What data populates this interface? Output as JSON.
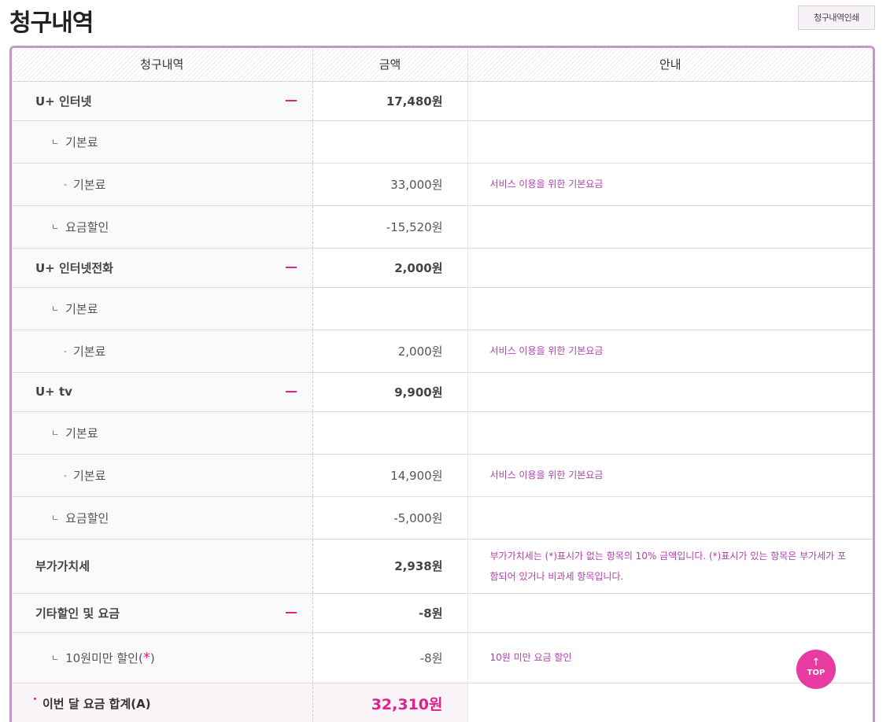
{
  "page": {
    "title": "청구내역",
    "print_button": "청구내역인쇄"
  },
  "table": {
    "headers": [
      "청구내역",
      "금액",
      "안내"
    ],
    "rows": [
      {
        "level": 0,
        "name": "U+ 인터넷",
        "amount": "17,480원",
        "info": "",
        "collapsible": true
      },
      {
        "level": 1,
        "marker": "ㄴ",
        "name": "기본료",
        "amount": "",
        "info": ""
      },
      {
        "level": 2,
        "marker": "-",
        "name": "기본료",
        "amount": "33,000원",
        "info": "서비스 이용을 위한 기본요금"
      },
      {
        "level": 1,
        "marker": "ㄴ",
        "name": "요금할인",
        "amount": "-15,520원",
        "info": ""
      },
      {
        "level": 0,
        "name": "U+ 인터넷전화",
        "amount": "2,000원",
        "info": "",
        "collapsible": true
      },
      {
        "level": 1,
        "marker": "ㄴ",
        "name": "기본료",
        "amount": "",
        "info": ""
      },
      {
        "level": 2,
        "marker": "-",
        "name": "기본료",
        "amount": "2,000원",
        "info": "서비스 이용을 위한 기본요금"
      },
      {
        "level": 0,
        "name": "U+ tv",
        "amount": "9,900원",
        "info": "",
        "collapsible": true
      },
      {
        "level": 1,
        "marker": "ㄴ",
        "name": "기본료",
        "amount": "",
        "info": ""
      },
      {
        "level": 2,
        "marker": "-",
        "name": "기본료",
        "amount": "14,900원",
        "info": "서비스 이용을 위한 기본요금"
      },
      {
        "level": 1,
        "marker": "ㄴ",
        "name": "요금할인",
        "amount": "-5,000원",
        "info": ""
      },
      {
        "level": 0,
        "name": "부가가치세",
        "amount": "2,938원",
        "info": "부가가치세는 (*)표시가 없는 항목의 10% 금액입니다. (*)표시가 있는 항목은 부가세가 포함되어 있거나 비과세 항목입니다.",
        "collapsible": false
      },
      {
        "level": 0,
        "name": "기타할인 및 요금",
        "amount": "-8원",
        "info": "",
        "collapsible": true
      },
      {
        "level": 1,
        "marker": "ㄴ",
        "name": "10원미만 할인",
        "asterisk": "(*)",
        "amount": "-8원",
        "info": "10원 미만 요금 할인"
      }
    ],
    "total": {
      "label": "이번 달 요금 합계(A)",
      "amount": "32,310원"
    }
  },
  "top_button": {
    "arrow": "↑",
    "label": "TOP"
  },
  "colors": {
    "accent": "#e0218a",
    "border": "#c597c9",
    "info_text": "#b040b0"
  }
}
